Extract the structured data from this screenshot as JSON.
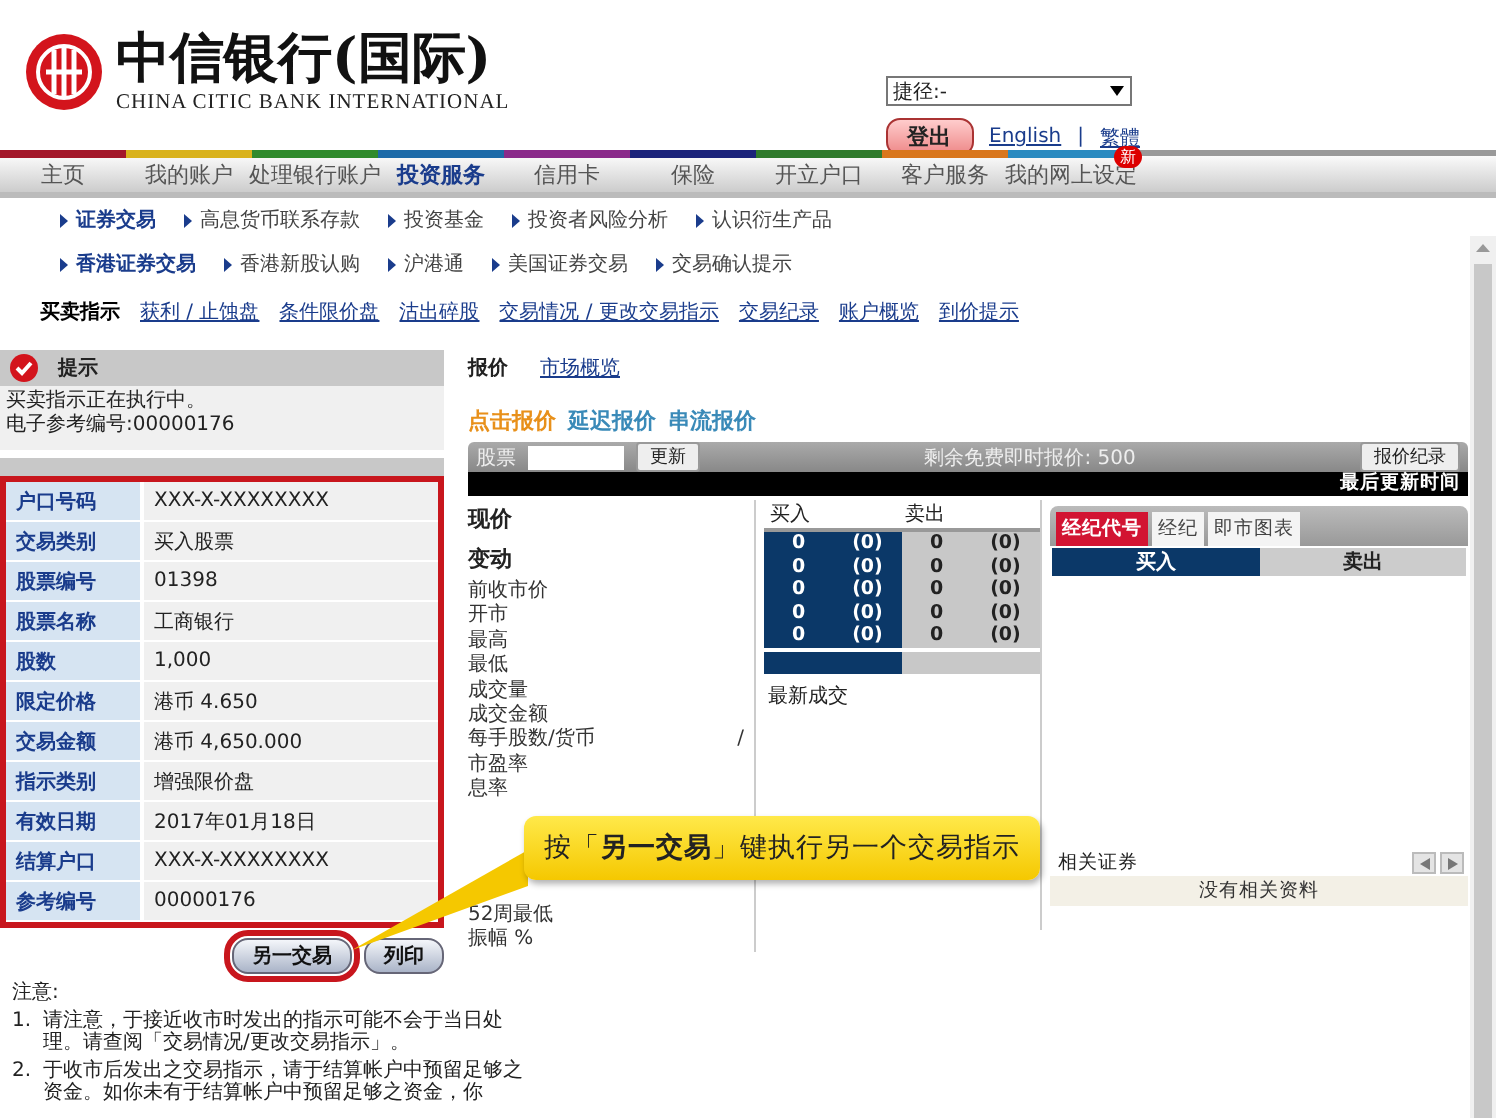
{
  "header": {
    "bank_name": "中信银行(国际)",
    "bank_name_en": "CHINA CITIC BANK INTERNATIONAL",
    "shortcut": "捷径:-",
    "logout": "登出",
    "languages": [
      "English",
      "繁體"
    ],
    "separator": "|"
  },
  "main_nav": [
    {
      "label": "主页",
      "selected": false,
      "color": "#a3172a"
    },
    {
      "label": "我的账户",
      "selected": false,
      "color": "#d9b21c"
    },
    {
      "label": "处理银行账户",
      "selected": false,
      "color": "#2f8a2c"
    },
    {
      "label": "投资服务",
      "selected": true,
      "color": "#1c6aa8"
    },
    {
      "label": "信用卡",
      "selected": false,
      "color": "#8a2a8a"
    },
    {
      "label": "保险",
      "selected": false,
      "color": "#1b237a"
    },
    {
      "label": "开立户口",
      "selected": false,
      "color": "#2f7a2c"
    },
    {
      "label": "客户服务",
      "selected": false,
      "color": "#d9761c"
    },
    {
      "label": "我的网上设定",
      "selected": false,
      "color": "#2a8ac0",
      "badge": "新"
    }
  ],
  "sub_nav_rows": [
    {
      "items": [
        {
          "label": "证券交易",
          "selected": true
        },
        {
          "label": "高息货币联系存款",
          "selected": false
        },
        {
          "label": "投资基金",
          "selected": false
        },
        {
          "label": "投资者风险分析",
          "selected": false
        },
        {
          "label": "认识衍生产品",
          "selected": false
        }
      ]
    },
    {
      "items": [
        {
          "label": "香港证券交易",
          "selected": true
        },
        {
          "label": "香港新股认购",
          "selected": false
        },
        {
          "label": "沪港通",
          "selected": false
        },
        {
          "label": "美国证券交易",
          "selected": false
        },
        {
          "label": "交易确认提示",
          "selected": false
        }
      ]
    }
  ],
  "function_tabs": [
    {
      "label": "买卖指示",
      "selected": true
    },
    {
      "label": "获利 / 止蚀盘",
      "selected": false
    },
    {
      "label": "条件限价盘",
      "selected": false
    },
    {
      "label": "沽出碎股",
      "selected": false
    },
    {
      "label": "交易情况 / 更改交易指示",
      "selected": false
    },
    {
      "label": "交易纪录",
      "selected": false
    },
    {
      "label": "账户概览",
      "selected": false
    },
    {
      "label": "到价提示",
      "selected": false
    }
  ],
  "notice": {
    "title": "提示",
    "lines": [
      "买卖指示正在执行中。",
      "电子参考编号:00000176"
    ]
  },
  "order_details": [
    {
      "label": "户口号码",
      "value": "XXX-X-XXXXXXXX"
    },
    {
      "label": "交易类别",
      "value": "买入股票"
    },
    {
      "label": "股票编号",
      "value": "01398"
    },
    {
      "label": "股票名称",
      "value": "工商银行"
    },
    {
      "label": "股数",
      "value": "1,000"
    },
    {
      "label": "限定价格",
      "value": "港币 4.650"
    },
    {
      "label": "交易金额",
      "value": "港币 4,650.000"
    },
    {
      "label": "指示类别",
      "value": "增强限价盘"
    },
    {
      "label": "有效日期",
      "value": "2017年01月18日"
    },
    {
      "label": "结算户口",
      "value": "XXX-X-XXXXXXXX"
    },
    {
      "label": "参考编号",
      "value": "00000176"
    }
  ],
  "buttons": [
    {
      "label": "另一交易",
      "highlighted": true
    },
    {
      "label": "列印",
      "highlighted": false
    }
  ],
  "notes": {
    "title": "注意:",
    "items": [
      {
        "number": "1.",
        "text": "请注意，于接近收市时发出的指示可能不会于当日处理。请查阅「交易情况/更改交易指示」。"
      },
      {
        "number": "2.",
        "text": "于收市后发出之交易指示，请于结算帐户中预留足够之资金。如你未有于结算帐户中预留足够之资金，你"
      }
    ]
  },
  "quote": {
    "title": "报价",
    "link": "市场概览",
    "modes": [
      {
        "label": "点击报价",
        "selected": true
      },
      {
        "label": "延迟报价",
        "selected": false
      },
      {
        "label": "串流报价",
        "selected": false
      }
    ],
    "stock_label": "股票",
    "refresh": "更新",
    "free_quotes": "剩余免费即时报价: 500",
    "history": "报价纪录",
    "last_update": "最后更新时间",
    "headline_labels": [
      "现价",
      "变动"
    ],
    "labels_top": [
      {
        "label": "前收市价"
      },
      {
        "label": "开市"
      },
      {
        "label": "最高"
      },
      {
        "label": "最低"
      },
      {
        "label": "成交量"
      },
      {
        "label": "成交金额"
      },
      {
        "label": "每手股数/货币",
        "value": "/"
      },
      {
        "label": "市盈率"
      },
      {
        "label": "息率"
      }
    ],
    "labels_bottom": [
      {
        "label": "52周最低"
      },
      {
        "label": "振幅 %"
      }
    ]
  },
  "depth": {
    "headers": [
      "买入",
      "卖出"
    ],
    "rows": [
      {
        "bid": "0",
        "bid_count": "(0)",
        "ask": "0",
        "ask_count": "(0)"
      },
      {
        "bid": "0",
        "bid_count": "(0)",
        "ask": "0",
        "ask_count": "(0)"
      },
      {
        "bid": "0",
        "bid_count": "(0)",
        "ask": "0",
        "ask_count": "(0)"
      },
      {
        "bid": "0",
        "bid_count": "(0)",
        "ask": "0",
        "ask_count": "(0)"
      },
      {
        "bid": "0",
        "bid_count": "(0)",
        "ask": "0",
        "ask_count": "(0)"
      }
    ],
    "latest_trade": "最新成交"
  },
  "broker": {
    "tabs": [
      {
        "label": "经纪代号",
        "selected": true
      },
      {
        "label": "经纪",
        "selected": false
      },
      {
        "label": "即市图表",
        "selected": false
      }
    ],
    "sides": [
      {
        "label": "买入",
        "selected": true
      },
      {
        "label": "卖出",
        "selected": false
      }
    ],
    "related": "相关证券",
    "empty": "没有相关资料"
  },
  "callout": "按「**另一交易**」键执行另一个交易指示"
}
